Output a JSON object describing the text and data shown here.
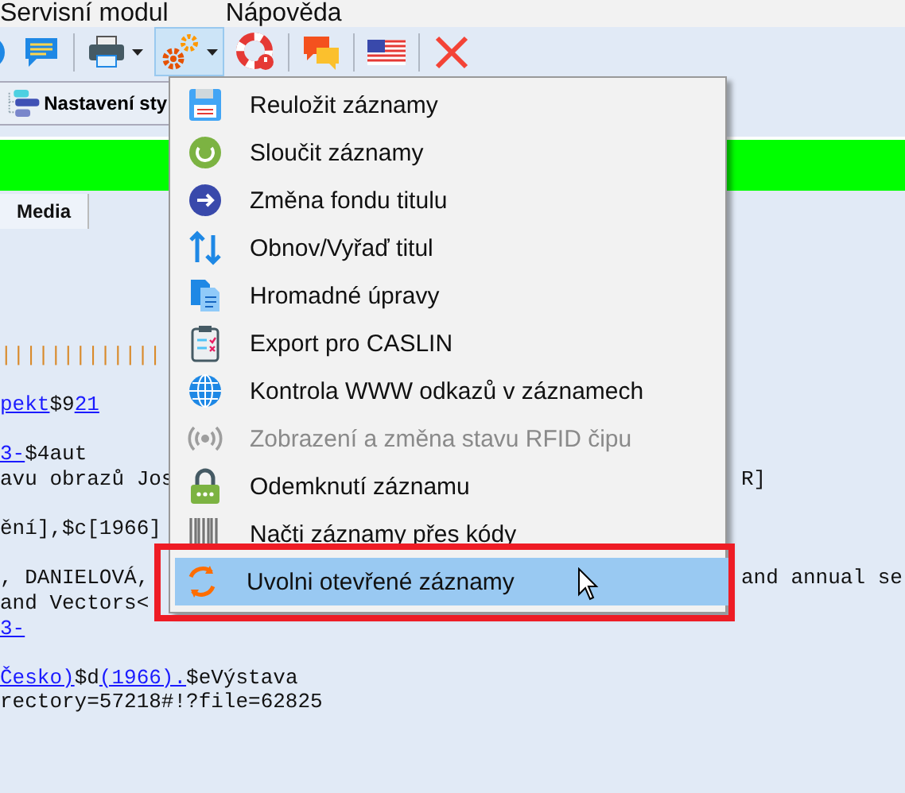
{
  "menu_bar": {
    "items": [
      "Servisní modul",
      "Nápověda"
    ]
  },
  "toolbar": {
    "buttons": [
      {
        "kind": "info",
        "pressed": false
      },
      {
        "kind": "note",
        "pressed": false
      },
      {
        "kind": "printer",
        "pressed": false
      },
      {
        "kind": "gears",
        "pressed": true
      },
      {
        "kind": "help",
        "pressed": false
      },
      {
        "kind": "chat",
        "pressed": false
      },
      {
        "kind": "flag",
        "pressed": false
      },
      {
        "kind": "close",
        "pressed": false
      }
    ]
  },
  "style_button": {
    "label": "Nastavení sty"
  },
  "tabs": [
    {
      "label": "Media",
      "selected": true
    }
  ],
  "content": {
    "blocks": [
      [
        [
          {
            "text": "|||||||||||||",
            "link": false,
            "color": "#d98a2b"
          }
        ]
      ],
      [
        [
          {
            "text": "pekt",
            "link": true
          },
          {
            "text": "$9",
            "link": false
          },
          {
            "text": "21",
            "link": true
          }
        ]
      ],
      [
        [
          {
            "text": "3-",
            "link": true
          },
          {
            "text": "$4aut",
            "link": false
          }
        ],
        [
          {
            "text": "avu obrazů Jos",
            "link": false
          },
          {
            "text": "R]",
            "link": false,
            "right": true
          }
        ]
      ],
      [
        [
          {
            "text": "ění],$c[1966]",
            "link": false
          }
        ]
      ],
      [
        [
          {
            "text": ", DANIELOVÁ,",
            "link": false
          },
          {
            "text": "and annual se",
            "link": false,
            "right": true
          }
        ],
        [
          {
            "text": "and Vectors<",
            "link": false
          }
        ],
        [
          {
            "text": "3-",
            "link": true
          }
        ]
      ],
      [
        [
          {
            "text": "Česko)",
            "link": true
          },
          {
            "text": "$d",
            "link": false
          },
          {
            "text": "(1966).",
            "link": true
          },
          {
            "text": "$eVýstava",
            "link": false
          }
        ],
        [
          {
            "text": "rectory=57218#!?file=62825",
            "link": false
          }
        ]
      ]
    ]
  },
  "dropdown": {
    "items": [
      {
        "label": "Reuložit záznamy",
        "disabled": false,
        "selected": false
      },
      {
        "label": "Sloučit záznamy",
        "disabled": false,
        "selected": false
      },
      {
        "label": "Změna fondu titulu",
        "disabled": false,
        "selected": false
      },
      {
        "label": "Obnov/Vyřaď titul",
        "disabled": false,
        "selected": false
      },
      {
        "label": "Hromadné úpravy",
        "disabled": false,
        "selected": false
      },
      {
        "label": "Export pro CASLIN",
        "disabled": false,
        "selected": false
      },
      {
        "label": "Kontrola WWW odkazů v záznamech",
        "disabled": false,
        "selected": false
      },
      {
        "label": "Zobrazení a změna stavu RFID čipu",
        "disabled": true,
        "selected": false
      },
      {
        "label": "Odemknutí záznamu",
        "disabled": false,
        "selected": false
      },
      {
        "label": "Načti záznamy přes kódy",
        "disabled": false,
        "selected": false
      },
      {
        "label": "Uvolni otevřené záznamy",
        "disabled": false,
        "selected": true
      }
    ]
  }
}
